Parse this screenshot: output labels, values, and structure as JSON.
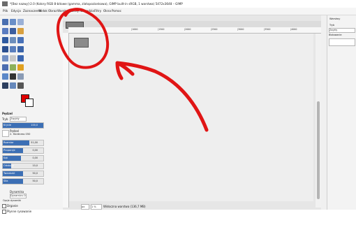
{
  "window": {
    "title": "*[Bez nazwy]-2.0 (Kolory RGB 8-bitowe (gamma, zlatopozionkowa), GIMP built-in sRGB, 1 warstwa) 5472x3648 – GIMP"
  },
  "menubar": {
    "items": [
      "Plik",
      "Edycja",
      "Zaznaczenie",
      "Widok",
      "Obraz",
      "Warstwa",
      "Kolory",
      "Narzędzia",
      "Filtry",
      "Okna",
      "Pomoc"
    ]
  },
  "tool_options": {
    "dock_tabs_title": "Pędzel",
    "type_label": "Tryb",
    "type_value": "Zwykły",
    "opacity_label": "Krycie",
    "opacity_value": "100,0",
    "brush_label": "Pędzel",
    "brush_value": "2. Hardness 050",
    "sliders": [
      {
        "label": "Rozmiar",
        "value": "51,00",
        "fill": 0.65
      },
      {
        "label": "Proporcje",
        "value": "0,00",
        "fill": 0.5
      },
      {
        "label": "Kąt",
        "value": "0,00",
        "fill": 0.45
      },
      {
        "label": "Odstępy",
        "value": "10,0",
        "fill": 0.2
      },
      {
        "label": "Twardość",
        "value": "50,0",
        "fill": 0.5
      },
      {
        "label": "Siła",
        "value": "50,0",
        "fill": 0.5
      }
    ],
    "dynamics_label": "Dynamika",
    "dynamics_value": "Dynamics Off",
    "dynamics_options": "Opcje dynamiki",
    "checkbox_1": "Drganie",
    "checkbox_2": "Płynne rysowanie"
  },
  "canvas": {
    "ruler_ticks": [
      "|1000",
      "|1500",
      "|2000",
      "|2500",
      "|3000",
      "|3500",
      "|4000"
    ],
    "zoom": "1 %",
    "unit": "px",
    "status": "Widoczna warstwa (136,7 MB)"
  },
  "right_dock": {
    "tab_label": "Warstwy",
    "mode_label": "Tryb",
    "mode_value": "Zwykły",
    "lock_label": "Blokowanie:"
  },
  "colors": {
    "foreground": "#e00000",
    "background": "#ffffff",
    "annotation": "#e01515",
    "slider_fill": "#3c6fb5"
  }
}
